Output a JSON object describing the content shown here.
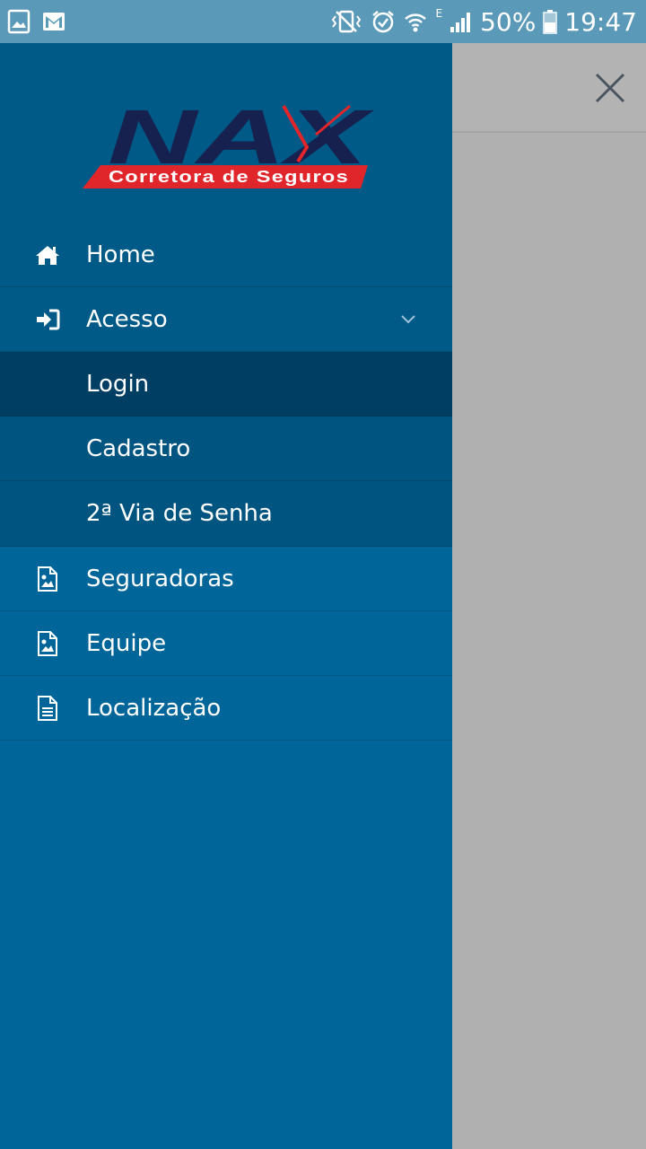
{
  "status_bar": {
    "battery_percent": "50%",
    "time": "19:47",
    "network_type": "E",
    "icons_left": [
      "image-icon",
      "gmail-icon"
    ],
    "icons_right": [
      "vibrate-mute-icon",
      "alarm-icon",
      "wifi-icon",
      "signal-icon",
      "battery-icon"
    ]
  },
  "brand": {
    "logo_text": "NAX",
    "logo_tagline": "Corretora de Seguros",
    "logo_colors": {
      "navy": "#16214f",
      "red": "#e0262b"
    }
  },
  "menu": {
    "home": {
      "label": "Home",
      "icon": "home-icon"
    },
    "acesso": {
      "label": "Acesso",
      "icon": "sign-in-icon",
      "expanded": true
    },
    "acesso_sub": [
      {
        "label": "Login",
        "active": true
      },
      {
        "label": "Cadastro",
        "active": false
      },
      {
        "label": "2ª Via de Senha",
        "active": false
      }
    ],
    "seguradoras": {
      "label": "Seguradoras",
      "icon": "image-file-icon"
    },
    "equipe": {
      "label": "Equipe",
      "icon": "image-file-icon"
    },
    "localizacao": {
      "label": "Localização",
      "icon": "text-file-icon"
    }
  },
  "colors": {
    "drawer_bg": "#006699",
    "drawer_dark": "#005a87",
    "active_item": "#003f63",
    "status_bar": "#5a99b8",
    "overlay": "#b0b0b0"
  }
}
